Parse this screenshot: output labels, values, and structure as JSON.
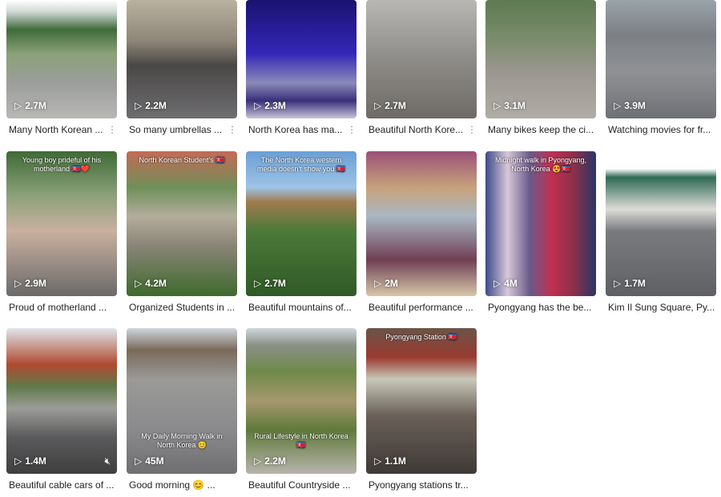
{
  "videos": [
    {
      "views": "2.7M",
      "caption": "Many North Korean ...",
      "more": true,
      "bg": "linear-gradient(#fff 0%,#cfd8d4 10%,#3f6b3a 25%,#8aa076 45%,#9c9e9c 70%,#b8b8b6 100%)"
    },
    {
      "views": "2.2M",
      "caption": "So many umbrellas ...",
      "more": true,
      "bg": "linear-gradient(#b9b2a0 0%,#8d8577 35%,#4a4846 55%,#6e6d70 100%)"
    },
    {
      "views": "2.3M",
      "caption": "North Korea has ma...",
      "more": true,
      "bg": "linear-gradient(#1a1370 0%,#3326b8 45%,#8a8ab8 70%,#3a2f7a 85%,#c8c5d8 100%)"
    },
    {
      "views": "2.7M",
      "caption": "Beautiful North Kore...",
      "more": true,
      "bg": "linear-gradient(#b9b7b3 0%,#8e8c88 50%,#6e6b67 100%)"
    },
    {
      "views": "3.1M",
      "caption": "Many bikes keep the ci...",
      "more": false,
      "bg": "linear-gradient(#5f7a52 0%,#7c8d6e 35%,#9a968f 60%,#b0aca6 100%)"
    },
    {
      "views": "3.9M",
      "caption": "Watching movies for fr...",
      "more": false,
      "bg": "linear-gradient(#9aa3aa 0%,#7c7f84 30%,#8f9194 60%,#6f7176 100%)"
    },
    {
      "views": "2.9M",
      "caption": "Proud of motherland ...",
      "overlay": "Young boy prideful of his motherland 🇰🇵❤️",
      "bg": "linear-gradient(#3f6a36 0%,#8ba079 30%,#c9b0a0 55%,#6a6a6a 100%)"
    },
    {
      "views": "4.2M",
      "caption": "Organized Students in ...",
      "overlay": "North Korean Student's 🇰🇵",
      "bg": "linear-gradient(#c46a56 0%,#6f8f58 25%,#b4ad9c 45%,#8a8577 65%,#3f6a2d 100%)"
    },
    {
      "views": "2.7M",
      "caption": "Beautiful mountains of...",
      "overlay": "The North Korea western media doesn't show you 🇰🇵",
      "bg": "linear-gradient(#6a9fd6 0%,#9ec3e6 25%,#a07a4e 35%,#4c7a3a 55%,#2f5a26 100%)"
    },
    {
      "views": "2M",
      "caption": "Beautiful performance ...",
      "bg": "linear-gradient(#9a5078 0%,#c7a27a 25%,#a9b7c3 45%,#6f3f54 75%,#d6c8a8 100%)"
    },
    {
      "views": "4M",
      "caption": "Pyongyang has the be...",
      "overlay": "Midnight walk in Pyongyang, North Korea 😍🇰🇵",
      "bg": "linear-gradient(90deg,#3c4a8a 0%,#d7c8d8 20%,#6a5a8a 40%,#c03050 60%,#8a3048 80%,#2a3568 100%)"
    },
    {
      "views": "1.7M",
      "caption": "Kim Il Sung Square, Py...",
      "bg": "linear-gradient(#fff 0%,#fff 12%,#2f6a55 18%,#dcdcd8 40%,#7a7b7e 55%,#5f6064 100%)"
    },
    {
      "views": "1.4M",
      "caption": "Beautiful cable cars of ...",
      "mute": true,
      "bg": "linear-gradient(#dfe6ec 0%,#b04a30 25%,#5f7a4a 40%,#9c9c98 55%,#5a5a5c 75%,#3f3f40 100%)"
    },
    {
      "views": "45M",
      "caption": "Good morning 😊 ...",
      "overlay_bottom": "My Daily Morning Walk in North Korea 😊",
      "bg": "linear-gradient(#cfd6dc 0%,#7a6a5a 15%,#9a9a98 35%,#8a8a8c 70%,#6f6f72 100%)"
    },
    {
      "views": "2.2M",
      "caption": "Beautiful Countryside ...",
      "overlay_bottom": "Rural Lifestyle in North Korea 🇰🇵",
      "bg": "linear-gradient(#d0d6dc 0%,#8a8f84 12%,#6f8a4a 30%,#a6976f 50%,#5f7a3a 70%,#b8b4ac 100%)"
    },
    {
      "views": "1.1M",
      "caption": "Pyongyang stations tr...",
      "overlay": "Pyongyang Station 🇰🇵",
      "bg": "linear-gradient(#6a5548 0%,#9b3a30 20%,#c8c8b8 35%,#6a6058 60%,#3f3a36 100%)"
    }
  ]
}
